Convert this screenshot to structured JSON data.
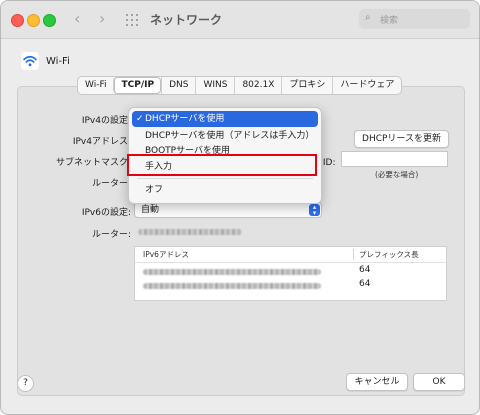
{
  "titlebar": {
    "title": "ネットワーク",
    "search_placeholder": "検索"
  },
  "interface": {
    "name": "Wi-Fi"
  },
  "tabs": [
    {
      "label": "Wi-Fi",
      "selected": false
    },
    {
      "label": "TCP/IP",
      "selected": true
    },
    {
      "label": "DNS",
      "selected": false
    },
    {
      "label": "WINS",
      "selected": false
    },
    {
      "label": "802.1X",
      "selected": false
    },
    {
      "label": "プロキシ",
      "selected": false
    },
    {
      "label": "ハードウェア",
      "selected": false
    }
  ],
  "form": {
    "ipv4_config_label": "IPv4の設定:",
    "ipv4_address_label": "IPv4アドレス:",
    "subnet_mask_label": "サブネットマスク:",
    "router_label": "ルーター:",
    "client_id_label": "ト ID:",
    "client_id_hint": "(必要な場合)",
    "renew_button": "DHCPリースを更新",
    "ipv6_config_label": "IPv6の設定:",
    "ipv6_config_value": "自動",
    "ipv6_router_label": "ルーター:"
  },
  "ipv6_table": {
    "headers": [
      "IPv6アドレス",
      "プレフィックス長"
    ],
    "rows": [
      {
        "prefix": "64"
      },
      {
        "prefix": "64"
      }
    ]
  },
  "dropdown_menu": {
    "items": [
      {
        "label": "DHCPサーバを使用",
        "selected": true,
        "check": "✓"
      },
      {
        "label": "DHCPサーバを使用（アドレスは手入力）",
        "selected": false
      },
      {
        "label": "BOOTPサーバを使用",
        "selected": false
      },
      {
        "label": "手入力",
        "selected": false,
        "highlighted": true
      },
      {
        "label": "オフ",
        "selected": false
      }
    ]
  },
  "footer": {
    "help": "?",
    "cancel": "キャンセル",
    "ok": "OK"
  },
  "colors": {
    "accent": "#2a68e0",
    "highlight_box": "#e60012"
  }
}
